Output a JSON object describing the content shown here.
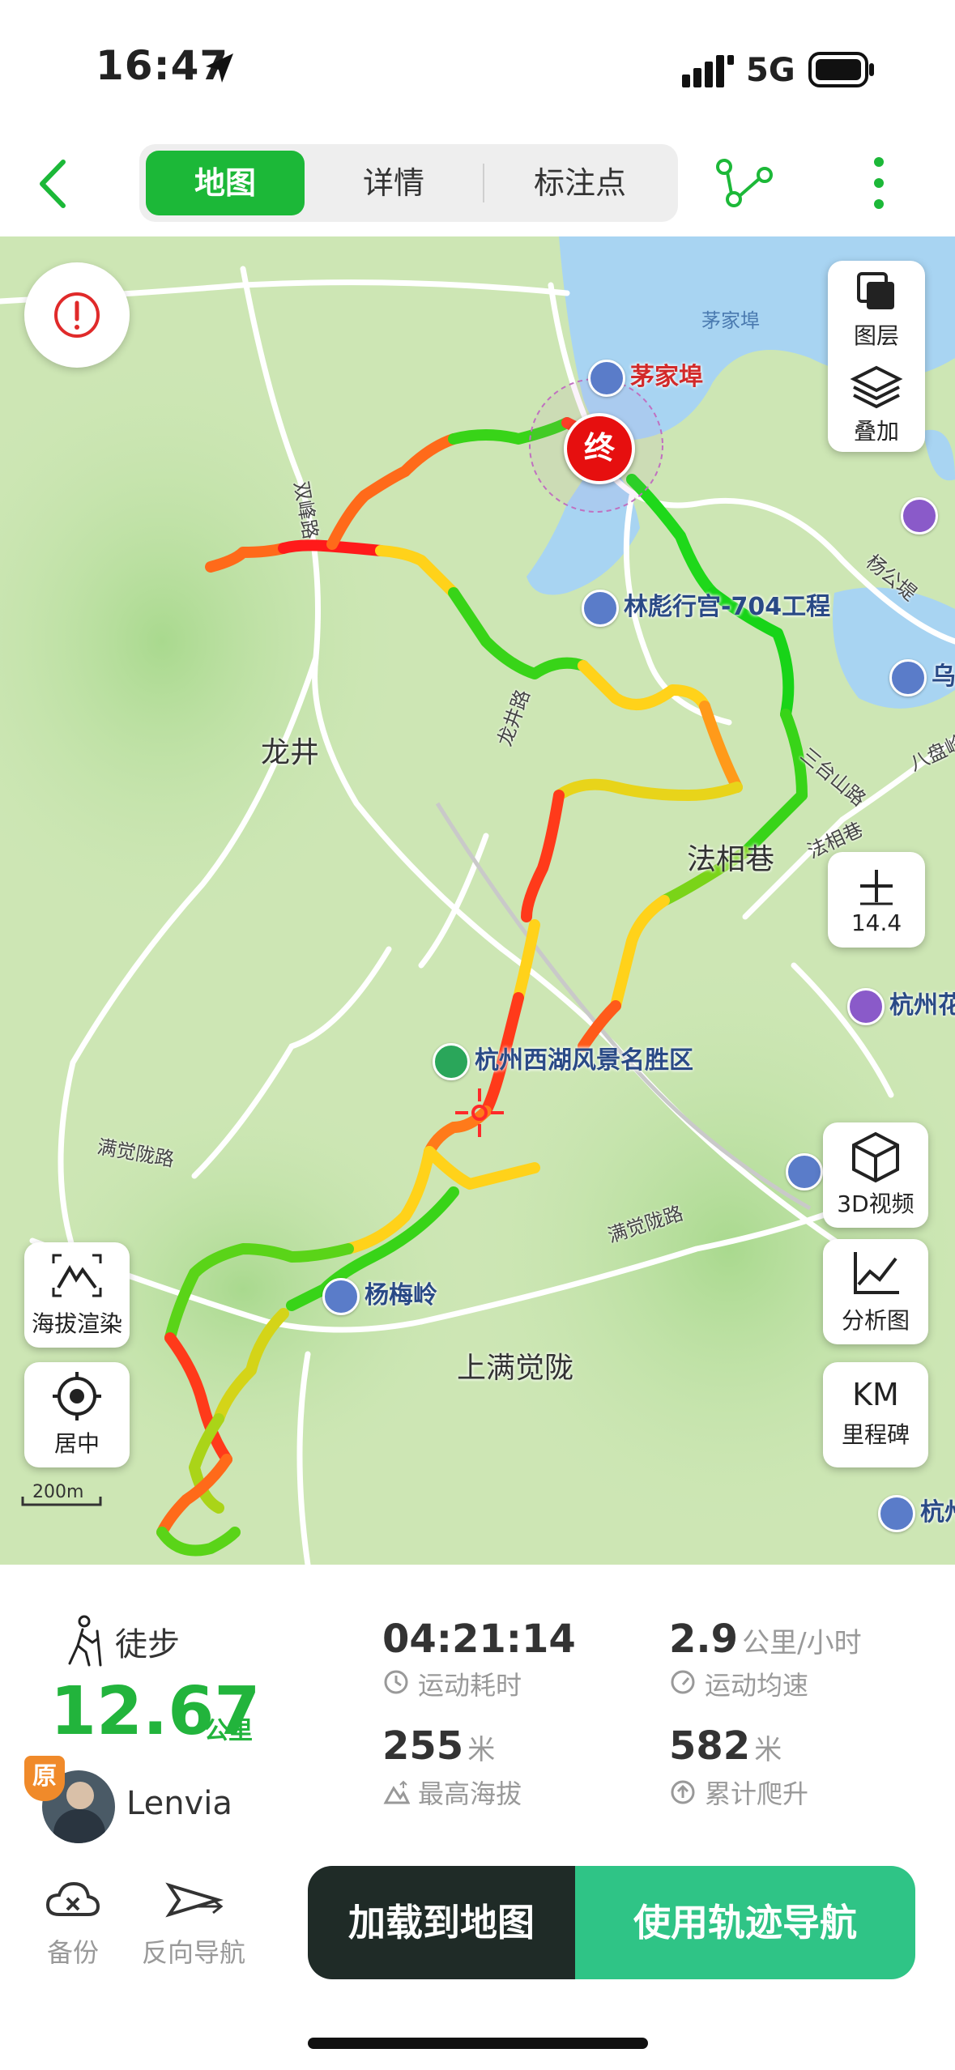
{
  "status_bar": {
    "time": "16:47",
    "network": "5G"
  },
  "nav": {
    "tabs": [
      {
        "label": "地图",
        "active": true
      },
      {
        "label": "详情",
        "active": false
      },
      {
        "label": "标注点",
        "active": false
      }
    ]
  },
  "map": {
    "layer_label": "图层",
    "overlay_label": "叠加",
    "zoom_level": "14.4",
    "video_label": "3D视频",
    "analysis_label": "分析图",
    "milestone_top": "KM",
    "milestone_label": "里程碑",
    "elevation_label": "海拔渲染",
    "center_label": "居中",
    "scale_label": "200m",
    "end_marker": "终",
    "pois": [
      "茅家埠",
      "林彪行宫-704工程",
      "杭州西湖风景名胜区",
      "杨梅岭",
      "杭州花",
      "乌",
      "杭州",
      "杭州"
    ],
    "areas": [
      "龙井",
      "法相巷",
      "上满觉陇"
    ],
    "roads": [
      "双峰路",
      "龙井路",
      "三台山路",
      "法相巷",
      "满觉陇路",
      "满觉陇路",
      "杨公堤",
      "八盘岭"
    ],
    "water": "茅家埠"
  },
  "activity": {
    "type": "徒步",
    "distance": "12.67",
    "distance_unit": "公里",
    "user_badge": "原",
    "user_name": "Lenvia",
    "duration": "04:21:14",
    "duration_label": "运动耗时",
    "speed": "2.9",
    "speed_unit": "公里/小时",
    "speed_label": "运动均速",
    "max_altitude": "255",
    "max_altitude_unit": "米",
    "max_altitude_label": "最高海拔",
    "climb": "582",
    "climb_unit": "米",
    "climb_label": "累计爬升"
  },
  "actions": {
    "backup": "备份",
    "reverse_nav": "反向导航",
    "load_to_map": "加载到地图",
    "use_track_nav": "使用轨迹导航"
  },
  "colors": {
    "accent": "#1cb838",
    "button_dark": "#1f2b27",
    "button_green": "#2fc486",
    "distance_green": "#22b43c"
  }
}
